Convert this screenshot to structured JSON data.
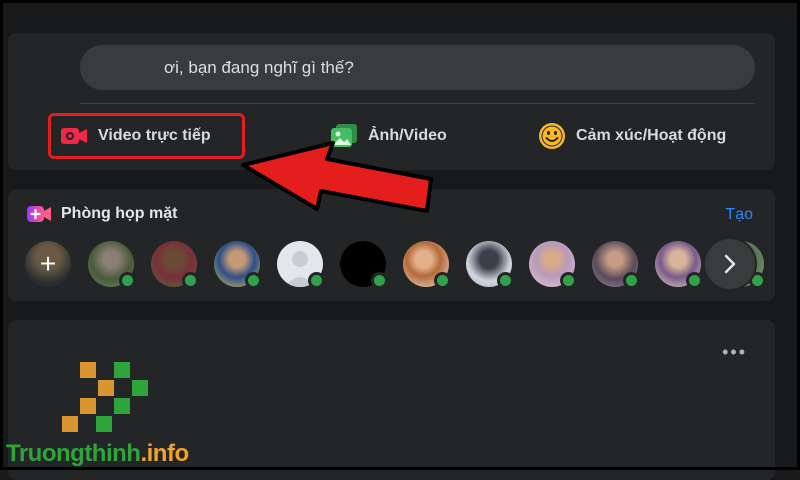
{
  "composer": {
    "placeholder": "ơi, bạn đang nghĩ gì thế?",
    "actions": [
      {
        "label": "Video trực tiếp",
        "icon": "live-video-icon"
      },
      {
        "label": "Ảnh/Video",
        "icon": "photo-video-icon"
      },
      {
        "label": "Cảm xúc/Hoạt động",
        "icon": "feeling-emoji-icon"
      }
    ]
  },
  "rooms": {
    "title": "Phòng họp mặt",
    "icon": "room-camera-icon",
    "create_label": "Tạo",
    "next_icon": "chevron-right-icon"
  },
  "post": {
    "more_icon": "more-dots-icon",
    "more_label": "•••"
  },
  "watermark": {
    "text_main": "Truongthinh",
    "text_suffix": ".info"
  },
  "colors": {
    "live": "#f02849",
    "photo": "#45bd62",
    "feeling": "#f7b928",
    "online": "#31a24c",
    "link": "#2d88ff",
    "annotation": "#e41d1d"
  }
}
